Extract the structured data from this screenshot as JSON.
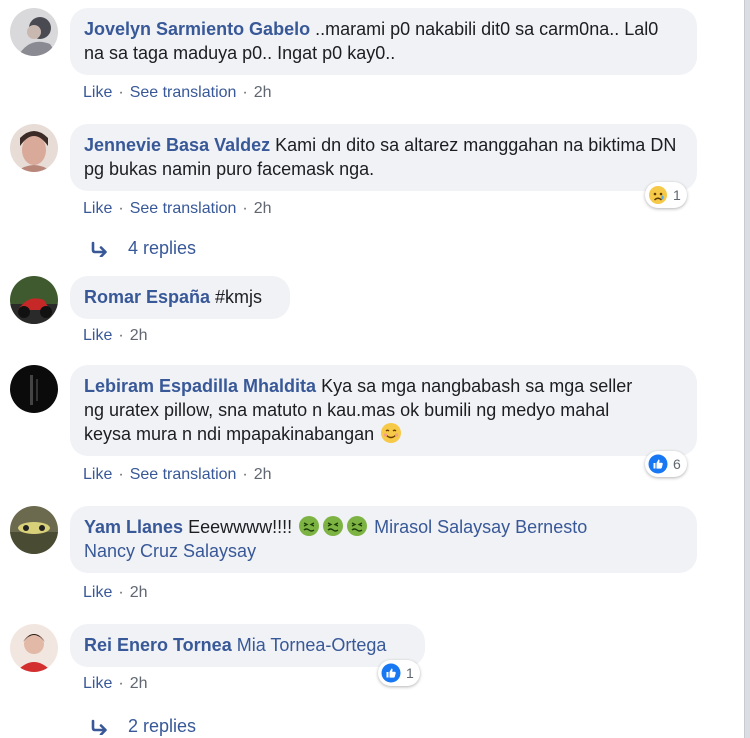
{
  "labels": {
    "like": "Like",
    "see_translation": "See translation",
    "sep": "·"
  },
  "comments": [
    {
      "author": "Jovelyn Sarmiento Gabelo",
      "text": "..marami p0 nakabili dit0 sa carm0na.. Lal0 na sa taga maduya p0.. Ingat p0 kay0..",
      "time": "2h"
    },
    {
      "author": "Jennevie Basa Valdez",
      "text": "Kami dn dito sa altarez manggahan na biktima DN pg bukas namin puro facemask nga.",
      "time": "2h",
      "reaction": {
        "icon": "sad-face-icon",
        "count": "1"
      },
      "replies": "4 replies"
    },
    {
      "author": "Romar España",
      "text": "#kmjs",
      "time": "2h"
    },
    {
      "author": "Lebiram Espadilla Mhaldita",
      "text_line1": "Kya sa mga nangbabash sa mga seller",
      "text_line2": "ng uratex pillow, sna matuto n kau.mas ok bumili ng medyo mahal",
      "text_line3": "keysa mura n ndi mpapakinabangan",
      "time": "2h",
      "reaction": {
        "icon": "like-thumb-icon",
        "count": "6"
      }
    },
    {
      "author": "Yam Llanes",
      "text": "Eeewwww!!!!",
      "mention1": "Mirasol Salaysay Bernesto",
      "mention2": "Nancy Cruz Salaysay",
      "time": "2h"
    },
    {
      "author": "Rei Enero Tornea",
      "mention": "Mia Tornea-Ortega",
      "time": "2h",
      "reaction": {
        "icon": "like-thumb-icon",
        "count": "1"
      },
      "replies": "2 replies"
    }
  ],
  "colors": {
    "link": "#385898",
    "bubble": "#f0f2f5",
    "meta": "#606770",
    "like_blue": "#1877f2"
  }
}
